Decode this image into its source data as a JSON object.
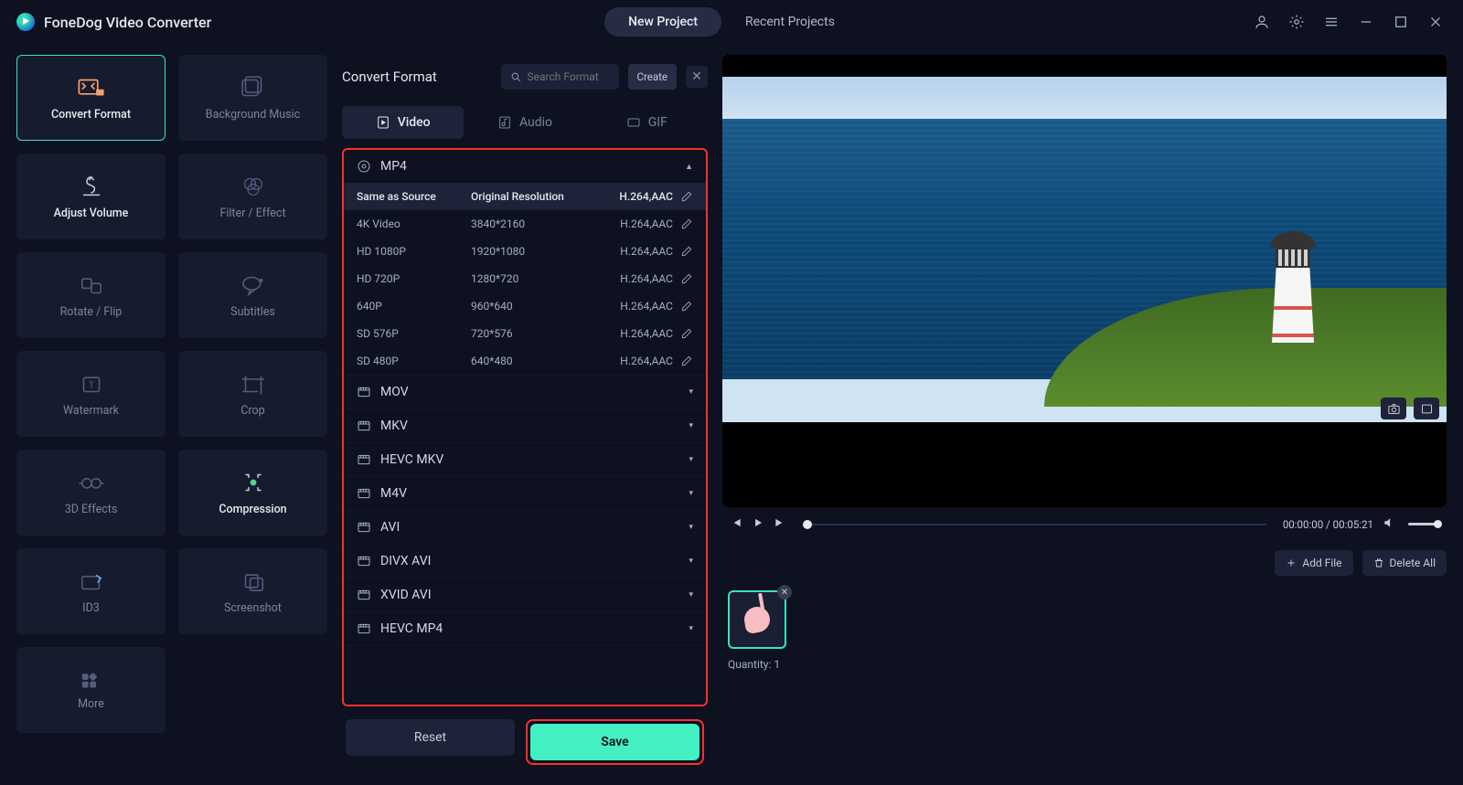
{
  "app": {
    "title": "FoneDog Video Converter"
  },
  "titlebar": {
    "tabs": {
      "new": "New Project",
      "recent": "Recent Projects"
    }
  },
  "tools": [
    {
      "id": "convert-format",
      "label": "Convert Format",
      "active": true
    },
    {
      "id": "background-music",
      "label": "Background Music"
    },
    {
      "id": "adjust-volume",
      "label": "Adjust Volume",
      "bright": true
    },
    {
      "id": "filter-effect",
      "label": "Filter / Effect"
    },
    {
      "id": "rotate-flip",
      "label": "Rotate / Flip"
    },
    {
      "id": "subtitles",
      "label": "Subtitles"
    },
    {
      "id": "watermark",
      "label": "Watermark"
    },
    {
      "id": "crop",
      "label": "Crop"
    },
    {
      "id": "3d-effects",
      "label": "3D Effects"
    },
    {
      "id": "compression",
      "label": "Compression",
      "bright": true
    },
    {
      "id": "id3",
      "label": "ID3"
    },
    {
      "id": "screenshot",
      "label": "Screenshot"
    },
    {
      "id": "more",
      "label": "More"
    }
  ],
  "format_panel": {
    "title": "Convert Format",
    "search_placeholder": "Search Format",
    "create": "Create",
    "tabs": {
      "video": "Video",
      "audio": "Audio",
      "gif": "GIF"
    },
    "reset": "Reset",
    "save": "Save"
  },
  "formats": {
    "mp4": {
      "label": "MP4",
      "expanded": true,
      "rows": [
        {
          "name": "Same as Source",
          "res": "Original Resolution",
          "codec": "H.264,AAC",
          "sel": true
        },
        {
          "name": "4K Video",
          "res": "3840*2160",
          "codec": "H.264,AAC"
        },
        {
          "name": "HD 1080P",
          "res": "1920*1080",
          "codec": "H.264,AAC"
        },
        {
          "name": "HD 720P",
          "res": "1280*720",
          "codec": "H.264,AAC"
        },
        {
          "name": "640P",
          "res": "960*640",
          "codec": "H.264,AAC"
        },
        {
          "name": "SD 576P",
          "res": "720*576",
          "codec": "H.264,AAC"
        },
        {
          "name": "SD 480P",
          "res": "640*480",
          "codec": "H.264,AAC"
        }
      ]
    },
    "others": [
      {
        "label": "MOV"
      },
      {
        "label": "MKV"
      },
      {
        "label": "HEVC MKV"
      },
      {
        "label": "M4V"
      },
      {
        "label": "AVI"
      },
      {
        "label": "DIVX AVI"
      },
      {
        "label": "XVID AVI"
      },
      {
        "label": "HEVC MP4"
      }
    ]
  },
  "preview": {
    "time_current": "00:00:00",
    "time_total": "00:05:21",
    "add_file": "Add File",
    "delete_all": "Delete All",
    "quantity_label": "Quantity:",
    "quantity": 1
  }
}
